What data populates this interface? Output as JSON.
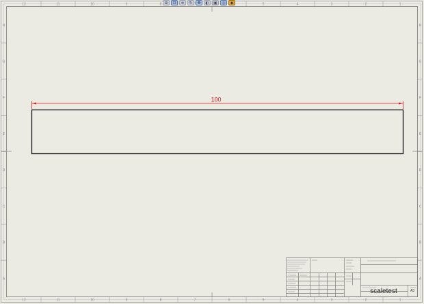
{
  "toolbar": {
    "items": [
      {
        "icon": "zoom-to-fit-icon"
      },
      {
        "icon": "zoom-area-icon"
      },
      {
        "icon": "zoom-in-out-icon"
      },
      {
        "icon": "rotate-icon"
      },
      {
        "icon": "pan-icon"
      },
      {
        "icon": "view-settings-icon"
      },
      {
        "icon": "display-style-icon"
      },
      {
        "icon": "hide-show-icon"
      },
      {
        "icon": "appearance-icon",
        "active": true
      }
    ]
  },
  "ruler": {
    "top_numbers": [
      "12",
      "11",
      "10",
      "9",
      "8",
      "7",
      "6",
      "5",
      "4",
      "3",
      "2",
      "1"
    ],
    "side_letters": [
      "H",
      "G",
      "F",
      "E",
      "D",
      "C",
      "B",
      "A"
    ]
  },
  "dimension": {
    "value": "100",
    "color": "#d42020"
  },
  "title_block": {
    "drawing_name": "scaletest",
    "sheet_size": "A3"
  },
  "colors": {
    "sheet_bg": "#ebebe4",
    "border_line": "#9a9a9a",
    "geometry_line": "#111111"
  }
}
